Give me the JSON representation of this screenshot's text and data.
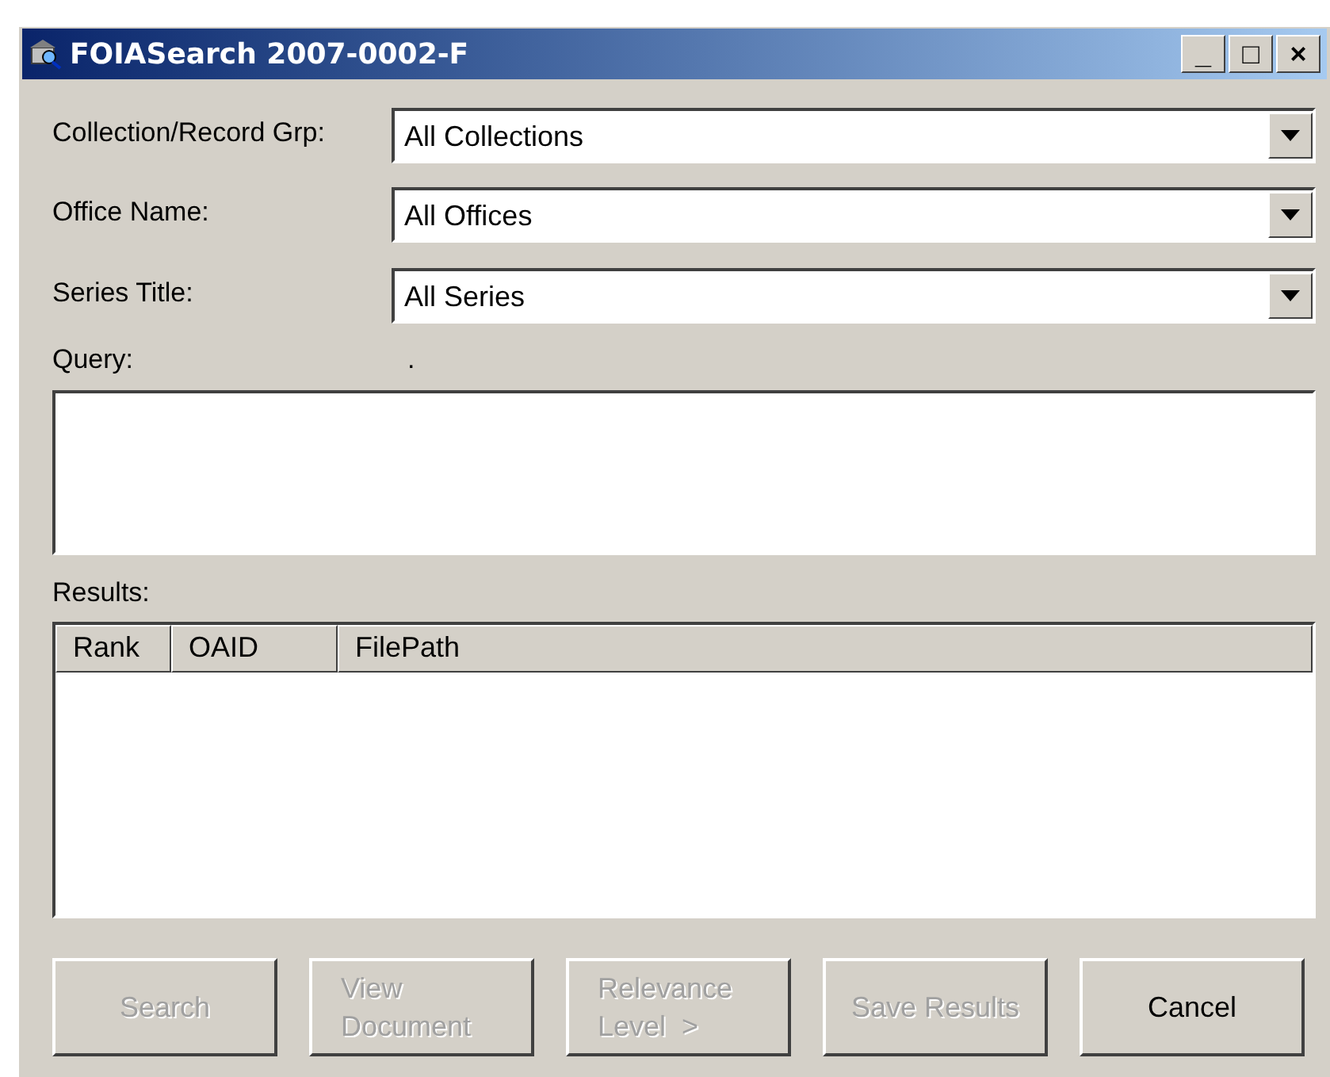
{
  "window": {
    "title": "FOIASearch 2007-0002-F",
    "controls": [
      "_",
      "□",
      "×"
    ]
  },
  "filters": [
    {
      "label": "Collection/Record Grp:",
      "value": "All Collections"
    },
    {
      "label": "Office Name:",
      "value": "All Offices"
    },
    {
      "label": "Series Title:",
      "value": "All Series"
    }
  ],
  "query": {
    "label": "Query:",
    "note": "."
  },
  "results": {
    "label": "Results:",
    "columns": [
      "Rank",
      "OAID",
      "FilePath"
    ]
  },
  "buttons": [
    {
      "label": "Search",
      "disabled": true
    },
    {
      "label": "View\nDocument",
      "disabled": true
    },
    {
      "label": "Relevance\nLevel  >",
      "disabled": true
    },
    {
      "label": "Save Results",
      "disabled": true
    },
    {
      "label": "Cancel",
      "disabled": false
    }
  ]
}
